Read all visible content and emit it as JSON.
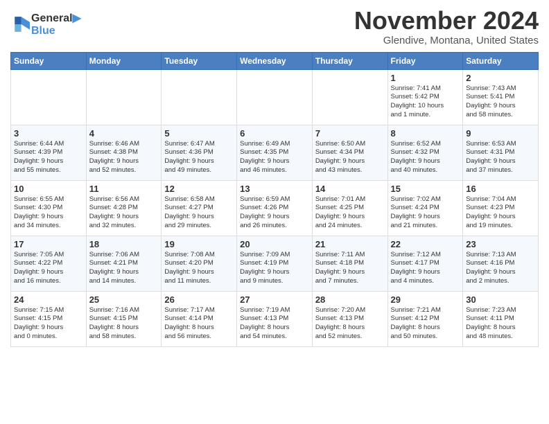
{
  "header": {
    "logo_line1": "General",
    "logo_line2": "Blue",
    "title": "November 2024",
    "subtitle": "Glendive, Montana, United States"
  },
  "weekdays": [
    "Sunday",
    "Monday",
    "Tuesday",
    "Wednesday",
    "Thursday",
    "Friday",
    "Saturday"
  ],
  "weeks": [
    [
      {
        "day": "",
        "info": ""
      },
      {
        "day": "",
        "info": ""
      },
      {
        "day": "",
        "info": ""
      },
      {
        "day": "",
        "info": ""
      },
      {
        "day": "",
        "info": ""
      },
      {
        "day": "1",
        "info": "Sunrise: 7:41 AM\nSunset: 5:42 PM\nDaylight: 10 hours\nand 1 minute."
      },
      {
        "day": "2",
        "info": "Sunrise: 7:43 AM\nSunset: 5:41 PM\nDaylight: 9 hours\nand 58 minutes."
      }
    ],
    [
      {
        "day": "3",
        "info": "Sunrise: 6:44 AM\nSunset: 4:39 PM\nDaylight: 9 hours\nand 55 minutes."
      },
      {
        "day": "4",
        "info": "Sunrise: 6:46 AM\nSunset: 4:38 PM\nDaylight: 9 hours\nand 52 minutes."
      },
      {
        "day": "5",
        "info": "Sunrise: 6:47 AM\nSunset: 4:36 PM\nDaylight: 9 hours\nand 49 minutes."
      },
      {
        "day": "6",
        "info": "Sunrise: 6:49 AM\nSunset: 4:35 PM\nDaylight: 9 hours\nand 46 minutes."
      },
      {
        "day": "7",
        "info": "Sunrise: 6:50 AM\nSunset: 4:34 PM\nDaylight: 9 hours\nand 43 minutes."
      },
      {
        "day": "8",
        "info": "Sunrise: 6:52 AM\nSunset: 4:32 PM\nDaylight: 9 hours\nand 40 minutes."
      },
      {
        "day": "9",
        "info": "Sunrise: 6:53 AM\nSunset: 4:31 PM\nDaylight: 9 hours\nand 37 minutes."
      }
    ],
    [
      {
        "day": "10",
        "info": "Sunrise: 6:55 AM\nSunset: 4:30 PM\nDaylight: 9 hours\nand 34 minutes."
      },
      {
        "day": "11",
        "info": "Sunrise: 6:56 AM\nSunset: 4:28 PM\nDaylight: 9 hours\nand 32 minutes."
      },
      {
        "day": "12",
        "info": "Sunrise: 6:58 AM\nSunset: 4:27 PM\nDaylight: 9 hours\nand 29 minutes."
      },
      {
        "day": "13",
        "info": "Sunrise: 6:59 AM\nSunset: 4:26 PM\nDaylight: 9 hours\nand 26 minutes."
      },
      {
        "day": "14",
        "info": "Sunrise: 7:01 AM\nSunset: 4:25 PM\nDaylight: 9 hours\nand 24 minutes."
      },
      {
        "day": "15",
        "info": "Sunrise: 7:02 AM\nSunset: 4:24 PM\nDaylight: 9 hours\nand 21 minutes."
      },
      {
        "day": "16",
        "info": "Sunrise: 7:04 AM\nSunset: 4:23 PM\nDaylight: 9 hours\nand 19 minutes."
      }
    ],
    [
      {
        "day": "17",
        "info": "Sunrise: 7:05 AM\nSunset: 4:22 PM\nDaylight: 9 hours\nand 16 minutes."
      },
      {
        "day": "18",
        "info": "Sunrise: 7:06 AM\nSunset: 4:21 PM\nDaylight: 9 hours\nand 14 minutes."
      },
      {
        "day": "19",
        "info": "Sunrise: 7:08 AM\nSunset: 4:20 PM\nDaylight: 9 hours\nand 11 minutes."
      },
      {
        "day": "20",
        "info": "Sunrise: 7:09 AM\nSunset: 4:19 PM\nDaylight: 9 hours\nand 9 minutes."
      },
      {
        "day": "21",
        "info": "Sunrise: 7:11 AM\nSunset: 4:18 PM\nDaylight: 9 hours\nand 7 minutes."
      },
      {
        "day": "22",
        "info": "Sunrise: 7:12 AM\nSunset: 4:17 PM\nDaylight: 9 hours\nand 4 minutes."
      },
      {
        "day": "23",
        "info": "Sunrise: 7:13 AM\nSunset: 4:16 PM\nDaylight: 9 hours\nand 2 minutes."
      }
    ],
    [
      {
        "day": "24",
        "info": "Sunrise: 7:15 AM\nSunset: 4:15 PM\nDaylight: 9 hours\nand 0 minutes."
      },
      {
        "day": "25",
        "info": "Sunrise: 7:16 AM\nSunset: 4:15 PM\nDaylight: 8 hours\nand 58 minutes."
      },
      {
        "day": "26",
        "info": "Sunrise: 7:17 AM\nSunset: 4:14 PM\nDaylight: 8 hours\nand 56 minutes."
      },
      {
        "day": "27",
        "info": "Sunrise: 7:19 AM\nSunset: 4:13 PM\nDaylight: 8 hours\nand 54 minutes."
      },
      {
        "day": "28",
        "info": "Sunrise: 7:20 AM\nSunset: 4:13 PM\nDaylight: 8 hours\nand 52 minutes."
      },
      {
        "day": "29",
        "info": "Sunrise: 7:21 AM\nSunset: 4:12 PM\nDaylight: 8 hours\nand 50 minutes."
      },
      {
        "day": "30",
        "info": "Sunrise: 7:23 AM\nSunset: 4:11 PM\nDaylight: 8 hours\nand 48 minutes."
      }
    ]
  ]
}
